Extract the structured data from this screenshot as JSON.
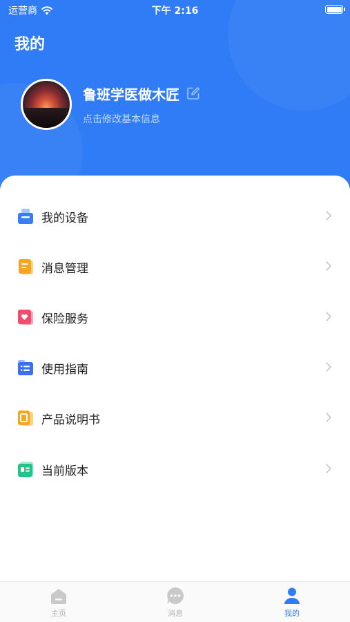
{
  "status_bar": {
    "carrier": "运营商",
    "time": "下午 2:16"
  },
  "header": {
    "title": "我的"
  },
  "profile": {
    "name": "鲁班学医做木匠",
    "subtitle": "点击修改基本信息"
  },
  "menu": [
    {
      "label": "我的设备",
      "icon": "device-icon",
      "color": "#3a7cf2"
    },
    {
      "label": "消息管理",
      "icon": "message-note-icon",
      "color": "#f5a524"
    },
    {
      "label": "保险服务",
      "icon": "insurance-heart-icon",
      "color": "#ef4d6b"
    },
    {
      "label": "使用指南",
      "icon": "guide-list-icon",
      "color": "#3a6ff2"
    },
    {
      "label": "产品说明书",
      "icon": "manual-book-icon",
      "color": "#f5a524"
    },
    {
      "label": "当前版本",
      "icon": "version-card-icon",
      "color": "#22c48a"
    }
  ],
  "tabbar": {
    "tabs": [
      {
        "label": "主页",
        "icon": "home-icon"
      },
      {
        "label": "消息",
        "icon": "chat-icon"
      },
      {
        "label": "我的",
        "icon": "user-icon",
        "active": true
      }
    ]
  },
  "colors": {
    "primary": "#2f7cf6",
    "tab_inactive": "#c4c4c4"
  }
}
